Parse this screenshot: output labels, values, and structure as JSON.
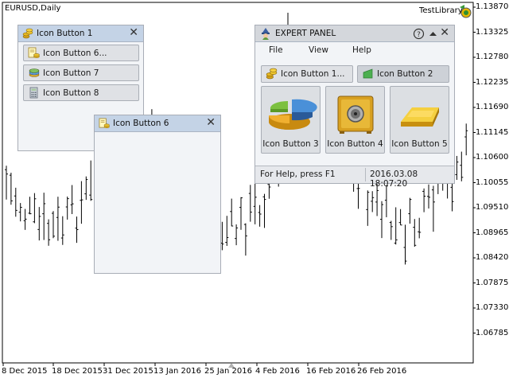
{
  "chart": {
    "symbol_label": "EURUSD,Daily",
    "library_label": "TestLibrary",
    "price_labels": [
      "1.13870",
      "1.13325",
      "1.12780",
      "1.12235",
      "1.11690",
      "1.11145",
      "1.10600",
      "1.10055",
      "1.09510",
      "1.08965",
      "1.08420",
      "1.07875",
      "1.07330",
      "1.06785"
    ],
    "date_labels": [
      "8 Dec 2015",
      "18 Dec 2015",
      "31 Dec 2015",
      "13 Jan 2016",
      "25 Jan 2016",
      "4 Feb 2016",
      "16 Feb 2016",
      "26 Feb 2016"
    ]
  },
  "colors": {
    "header_blue": "#c4d3e6",
    "panel_bg": "#f2f4f7",
    "button_bg": "#dfe1e5",
    "border": "#a8adb6"
  },
  "panel1": {
    "title": "Icon Button 1",
    "buttons": [
      {
        "label": "Icon Button 6...",
        "icon": "document-coins-icon"
      },
      {
        "label": "Icon Button 7",
        "icon": "database-icon"
      },
      {
        "label": "Icon Button 8",
        "icon": "calculator-icon"
      }
    ]
  },
  "panel2": {
    "title": "Icon Button 6"
  },
  "expert": {
    "title": "EXPERT PANEL",
    "menu": [
      "File",
      "View",
      "Help"
    ],
    "buttons": [
      {
        "label": "Icon Button 1...",
        "icon": "coins-icon"
      },
      {
        "label": "Icon Button 2",
        "icon": "green-flag-icon"
      }
    ],
    "big_buttons": [
      {
        "label": "Icon Button 3",
        "icon": "pie-chart-icon"
      },
      {
        "label": "Icon Button 4",
        "icon": "safe-icon"
      },
      {
        "label": "Icon Button 5",
        "icon": "gold-bar-icon"
      }
    ],
    "status_left": "For Help, press F1",
    "status_right": "2016.03.08 18:07:20"
  }
}
